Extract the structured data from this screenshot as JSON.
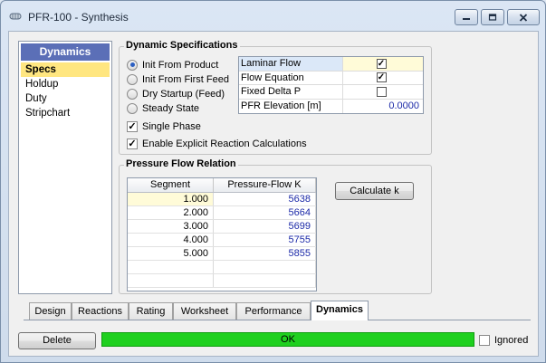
{
  "window": {
    "title": "PFR-100 - Synthesis"
  },
  "sidebar": {
    "header": "Dynamics",
    "items": [
      {
        "label": "Specs"
      },
      {
        "label": "Holdup"
      },
      {
        "label": "Duty"
      },
      {
        "label": "Stripchart"
      }
    ]
  },
  "dynamic_specs": {
    "title": "Dynamic Specifications",
    "init_options": [
      {
        "label": "Init From Product",
        "selected": true
      },
      {
        "label": "Init From First Feed",
        "selected": false
      },
      {
        "label": "Dry Startup (Feed)",
        "selected": false
      },
      {
        "label": "Steady State",
        "selected": false
      }
    ],
    "properties": [
      {
        "name": "Laminar Flow",
        "checked": true
      },
      {
        "name": "Flow Equation",
        "checked": true
      },
      {
        "name": "Fixed Delta P",
        "checked": false
      },
      {
        "name": "PFR Elevation [m]",
        "value": "0.0000"
      }
    ],
    "single_phase": {
      "label": "Single Phase",
      "checked": true
    },
    "explicit_reaction": {
      "label": "Enable Explicit Reaction Calculations",
      "checked": true
    }
  },
  "pressure_flow": {
    "title": "Pressure Flow Relation",
    "columns": [
      "Segment",
      "Pressure-Flow K"
    ],
    "rows": [
      {
        "segment": "1.000",
        "k": "5638"
      },
      {
        "segment": "2.000",
        "k": "5664"
      },
      {
        "segment": "3.000",
        "k": "5699"
      },
      {
        "segment": "4.000",
        "k": "5755"
      },
      {
        "segment": "5.000",
        "k": "5855"
      }
    ],
    "calculate_label": "Calculate k"
  },
  "tabs": [
    {
      "label": "Design"
    },
    {
      "label": "Reactions"
    },
    {
      "label": "Rating"
    },
    {
      "label": "Worksheet"
    },
    {
      "label": "Performance"
    },
    {
      "label": "Dynamics"
    }
  ],
  "footer": {
    "delete_label": "Delete",
    "status": "OK",
    "ignored_label": "Ignored",
    "ignored_checked": false
  },
  "colors": {
    "status_ok": "#1fd01f",
    "sidebar_header": "#5b6fb7",
    "selection": "#ffe680",
    "value_text": "#1c2aa8"
  },
  "icons": {
    "app": "reactor-icon",
    "minimize": "minimize-icon",
    "maximize": "maximize-icon",
    "close": "close-icon"
  }
}
